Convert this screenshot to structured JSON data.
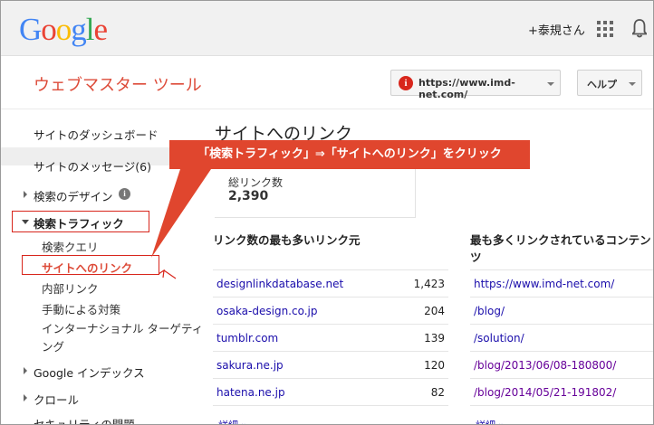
{
  "topbar": {
    "logo_letters": [
      {
        "ch": "G",
        "color": "#4285f4"
      },
      {
        "ch": "o",
        "color": "#ea4335"
      },
      {
        "ch": "o",
        "color": "#fbbc05"
      },
      {
        "ch": "g",
        "color": "#4285f4"
      },
      {
        "ch": "l",
        "color": "#34a853"
      },
      {
        "ch": "e",
        "color": "#ea4335"
      }
    ],
    "user_label": "+泰規さん",
    "apps_icon": "apps-grid-icon",
    "notify_icon": "bell-icon"
  },
  "header": {
    "app_title": "ウェブマスター ツール",
    "site_url": "https://www.imd-net.com/",
    "warning_glyph": "i",
    "help_label": "ヘルプ"
  },
  "sidebar": {
    "dashboard": "サイトのダッシュボード",
    "messages": "サイトのメッセージ(6)",
    "search_appearance": "検索のデザイン",
    "search_appearance_info": "i",
    "search_traffic": "検索トラフィック",
    "search_queries": "検索クエリ",
    "links_to_site": "サイトへのリンク",
    "internal_links": "内部リンク",
    "manual_actions": "手動による対策",
    "intl_targeting_1": "インターナショナル ターゲティ",
    "intl_targeting_2": "ング",
    "google_index": "Google インデックス",
    "crawl": "クロール",
    "security": "セキュリティの問題"
  },
  "main": {
    "title": "サイトへのリンク",
    "total_label": "総リンク数",
    "total_value": "2,390",
    "sources_heading": "リンク数の最も多いリンク元",
    "content_heading": "最も多くリンクされているコンテンツ",
    "sources": [
      {
        "domain": "designlinkdatabase.net",
        "count": "1,423"
      },
      {
        "domain": "osaka-design.co.jp",
        "count": "204"
      },
      {
        "domain": "tumblr.com",
        "count": "139"
      },
      {
        "domain": "sakura.ne.jp",
        "count": "120"
      },
      {
        "domain": "hatena.ne.jp",
        "count": "82"
      }
    ],
    "contents": [
      "https://www.imd-net.com/",
      "/blog/",
      "/solution/",
      "/blog/2013/06/08-180800/",
      "/blog/2014/05/21-191802/"
    ],
    "more_label": "詳細 »"
  },
  "annotation": {
    "callout_text": "「検索トラフィック」⇒「サイトへのリンク」をクリック",
    "color": "#e0462e"
  }
}
